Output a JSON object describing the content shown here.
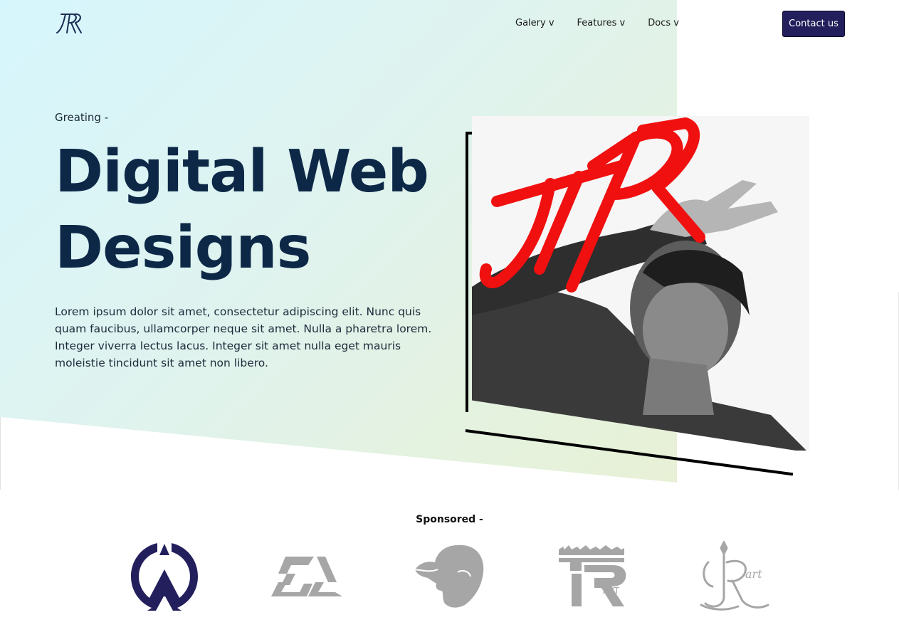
{
  "header": {
    "logo_text": "JPR",
    "nav": [
      {
        "label": "Galery v"
      },
      {
        "label": "Features v"
      },
      {
        "label": "Docs v"
      }
    ],
    "contact_label": "Contact us"
  },
  "hero": {
    "eyebrow": "Greating -",
    "title_line1": "Digital Web",
    "title_line2": "Designs",
    "body": "Lorem ipsum dolor sit amet, consectetur adipiscing elit. Nunc quis quam faucibus, ullamcorper neque sit amet. Nulla a pharetra lorem. Integer viverra lectus lacus. Integer sit amet nulla eget mauris moleistie tincidunt sit amet non libero.",
    "image_overlay_text": "JPR"
  },
  "sponsors": {
    "label": "Sponsored -",
    "items": [
      {
        "icon": "triangle-circle-logo-icon"
      },
      {
        "icon": "geometric-sl-logo-icon"
      },
      {
        "icon": "cap-profile-logo-icon"
      },
      {
        "icon": "tr-art-logo-icon",
        "text": "ART"
      },
      {
        "icon": "jr-art-logo-icon",
        "text": "art"
      }
    ]
  },
  "colors": {
    "title": "#0d2847",
    "button": "#221f5c",
    "sponsor_primary": "#221f5c",
    "sponsor_gray": "#a6a6a6",
    "overlay_red": "#f01010"
  }
}
